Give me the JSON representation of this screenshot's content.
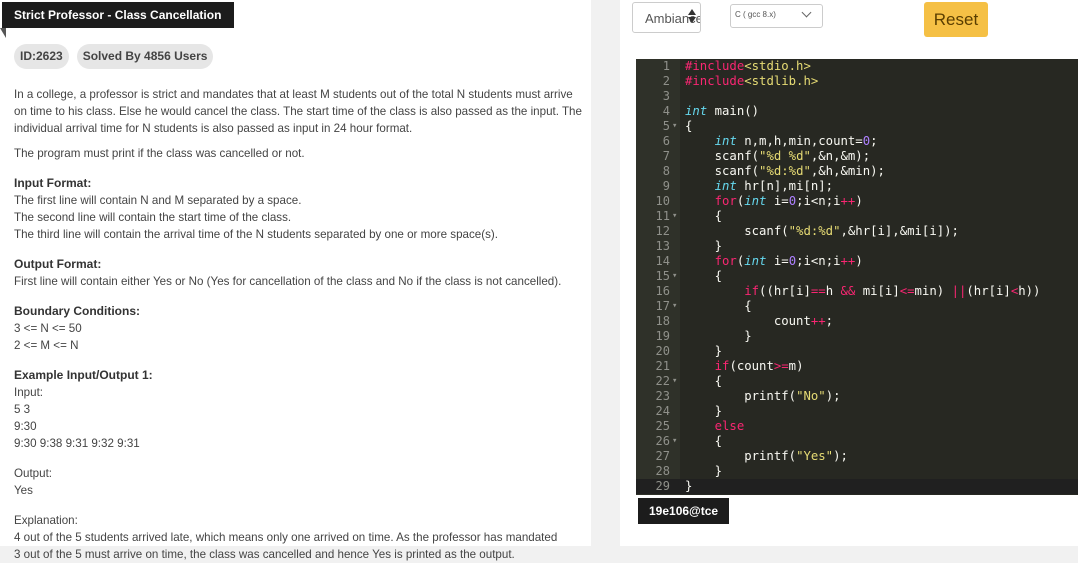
{
  "problem": {
    "title": "Strict Professor - Class Cancellation",
    "id_badge": "ID:2623",
    "solved_badge": "Solved By 4856 Users",
    "desc_1": "In a college, a professor is strict and mandates that at least M students out of the total N students must arrive on time to his class. Else he would cancel the class. The start time of the class is also passed as the input. The individual arrival time for N students is also passed as input in 24 hour format.",
    "desc_2": "The program must print if the class was cancelled or not.",
    "input_heading": "Input Format:",
    "input_1": "The first line will contain N and M separated by a space.",
    "input_2": "The second line will contain the start time of the class.",
    "input_3": "The third line will contain the arrival time of the N students separated by one or more space(s).",
    "output_heading": "Output Format:",
    "output_1": "First line will contain either Yes or No (Yes for cancellation of the class and No if the class is not cancelled).",
    "boundary_heading": "Boundary Conditions:",
    "boundary_1": "3 <= N <= 50",
    "boundary_2": "2 <= M <= N",
    "example_heading": "Example Input/Output 1:",
    "ex_input_label": "Input:",
    "ex_input_1": "5 3",
    "ex_input_2": "9:30",
    "ex_input_3": "9:30 9:38 9:31 9:32 9:31",
    "ex_output_label": "Output:",
    "ex_output_1": "Yes",
    "explanation_label": "Explanation:",
    "explanation_1": "4 out of the 5 students arrived late, which means only one arrived on time. As the professor has mandated",
    "explanation_2": "3 out of the 5 must arrive on time, the class was cancelled and hence Yes is printed as the output."
  },
  "toolbar": {
    "theme_value": "Ambiance",
    "compiler_value": "C ( gcc 8.x)",
    "reset_label": "Reset"
  },
  "editor": {
    "line_numbers": [
      "1",
      "2",
      "3",
      "4",
      "5",
      "6",
      "7",
      "8",
      "9",
      "10",
      "11",
      "12",
      "13",
      "14",
      "15",
      "16",
      "17",
      "18",
      "19",
      "20",
      "21",
      "22",
      "23",
      "24",
      "25",
      "26",
      "27",
      "28",
      "29"
    ],
    "fold_lines": [
      5,
      11,
      15,
      17,
      22,
      26
    ]
  },
  "user": {
    "handle": "19e106@tce"
  },
  "colors": {
    "editor_bg": "#272822",
    "reset_bg": "#f5c045",
    "tab_bg": "#1c1c1c"
  }
}
